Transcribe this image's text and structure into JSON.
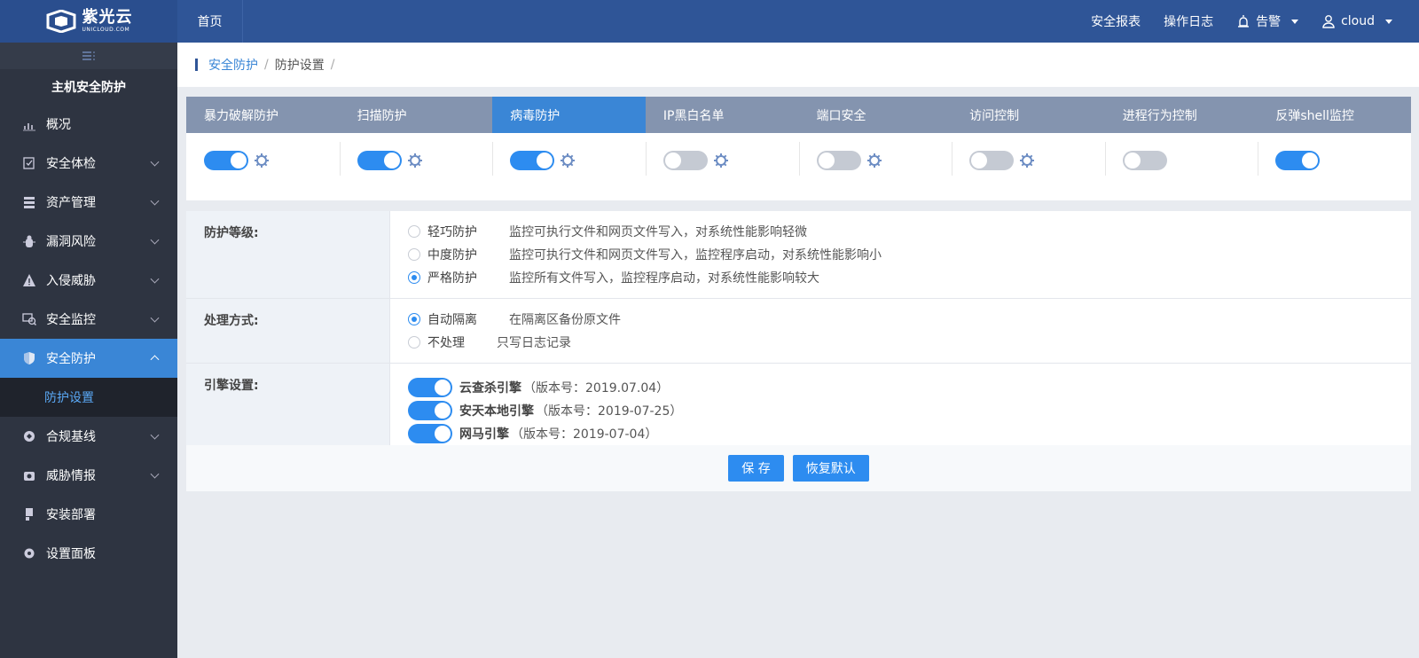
{
  "header": {
    "logo_text": "紫光云",
    "logo_sub": "UNICLOUD.COM",
    "home": "首页",
    "links": [
      "安全报表",
      "操作日志"
    ],
    "alert": "告警",
    "user": "cloud"
  },
  "sidebar": {
    "title": "主机安全防护",
    "items": [
      {
        "label": "概况",
        "icon": "chart-icon"
      },
      {
        "label": "安全体检",
        "icon": "checkup-icon"
      },
      {
        "label": "资产管理",
        "icon": "database-icon"
      },
      {
        "label": "漏洞风险",
        "icon": "bug-icon"
      },
      {
        "label": "入侵威胁",
        "icon": "warning-icon"
      },
      {
        "label": "安全监控",
        "icon": "monitor-icon"
      },
      {
        "label": "安全防护",
        "icon": "shield-icon"
      },
      {
        "label": "合规基线",
        "icon": "baseline-icon"
      },
      {
        "label": "威胁情报",
        "icon": "intel-icon"
      },
      {
        "label": "安装部署",
        "icon": "install-icon"
      },
      {
        "label": "设置面板",
        "icon": "settings-icon"
      }
    ],
    "sub_active": "防护设置"
  },
  "breadcrumb": {
    "parent": "安全防护",
    "current": "防护设置",
    "sep": "/"
  },
  "tabs": [
    "暴力破解防护",
    "扫描防护",
    "病毒防护",
    "IP黑白名单",
    "端口安全",
    "访问控制",
    "进程行为控制",
    "反弹shell监控"
  ],
  "toggles": [
    {
      "on": true,
      "gear": true
    },
    {
      "on": true,
      "gear": true
    },
    {
      "on": true,
      "gear": true
    },
    {
      "on": false,
      "gear": true
    },
    {
      "on": false,
      "gear": true
    },
    {
      "on": false,
      "gear": true
    },
    {
      "on": false,
      "gear": false
    },
    {
      "on": true,
      "gear": false
    }
  ],
  "settings": {
    "level": {
      "label": "防护等级:",
      "options": [
        {
          "name": "轻巧防护",
          "desc": "监控可执行文件和网页文件写入，对系统性能影响轻微",
          "selected": false
        },
        {
          "name": "中度防护",
          "desc": "监控可执行文件和网页文件写入，监控程序启动，对系统性能影响小",
          "selected": false
        },
        {
          "name": "严格防护",
          "desc": "监控所有文件写入，监控程序启动，对系统性能影响较大",
          "selected": true
        }
      ]
    },
    "handle": {
      "label": "处理方式:",
      "options": [
        {
          "name": "自动隔离",
          "desc": "在隔离区备份原文件",
          "selected": true
        },
        {
          "name": "不处理",
          "desc": "只写日志记录",
          "selected": false
        }
      ]
    },
    "engine": {
      "label": "引擎设置:",
      "items": [
        {
          "name": "云查杀引擎",
          "version": "（版本号：2019.07.04）"
        },
        {
          "name": "安天本地引擎",
          "version": "（版本号：2019-07-25）"
        },
        {
          "name": "网马引擎",
          "version": "（版本号：2019-07-04）"
        }
      ]
    }
  },
  "actions": {
    "save": "保 存",
    "reset": "恢复默认"
  },
  "colors": {
    "topbar": "#2f5597",
    "sidebar": "#2e3441",
    "accent": "#3a86d6",
    "toggle_on": "#2d8cf0"
  }
}
